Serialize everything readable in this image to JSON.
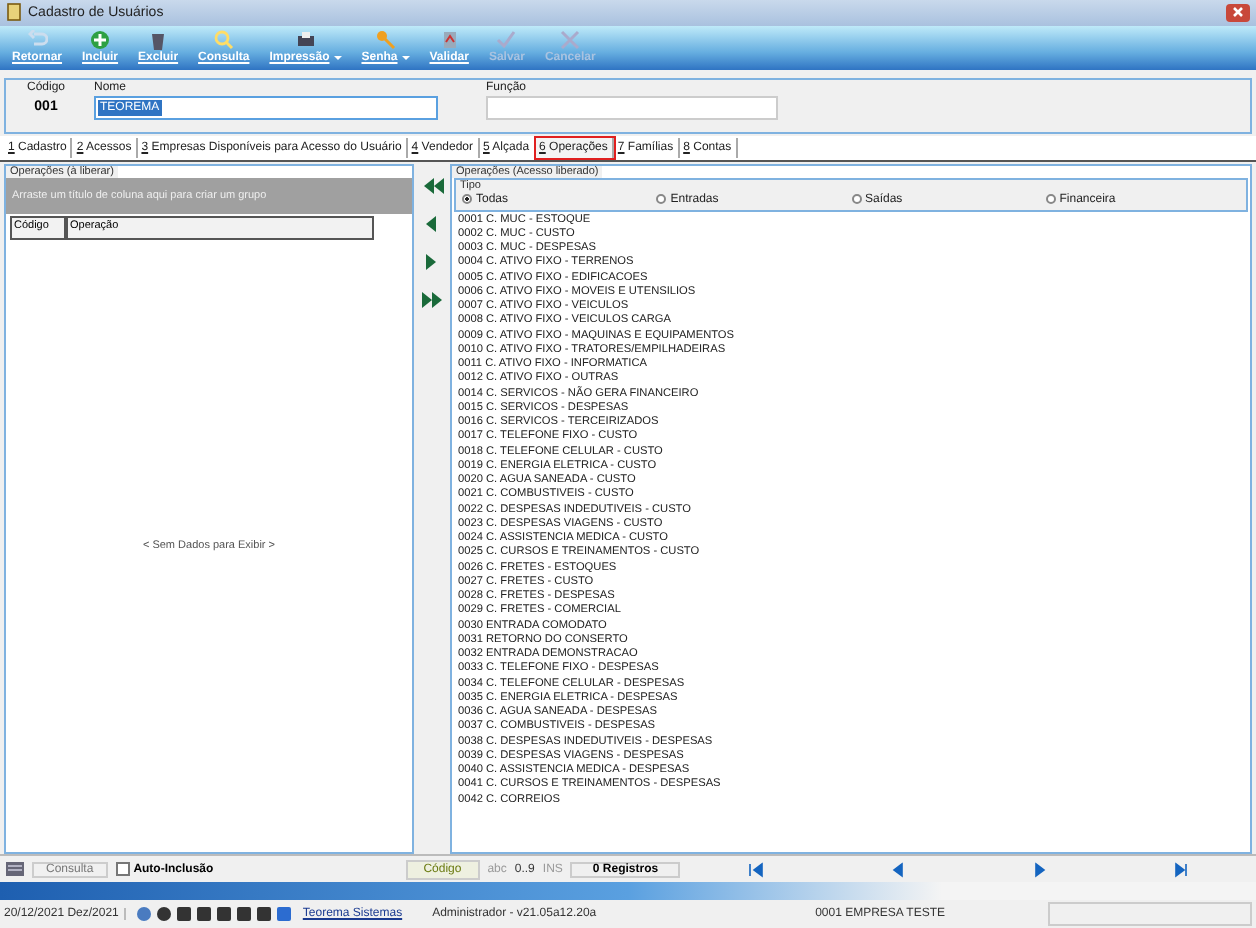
{
  "window": {
    "title": "Cadastro de Usuários"
  },
  "toolbar": [
    {
      "label": "Retornar",
      "disabled": false,
      "dropdown": false
    },
    {
      "label": "Incluir",
      "disabled": false,
      "dropdown": false
    },
    {
      "label": "Excluir",
      "disabled": false,
      "dropdown": false
    },
    {
      "label": "Consulta",
      "disabled": false,
      "dropdown": false
    },
    {
      "label": "Impressão",
      "disabled": false,
      "dropdown": true
    },
    {
      "label": "Senha",
      "disabled": false,
      "dropdown": true
    },
    {
      "label": "Validar",
      "disabled": false,
      "dropdown": false
    },
    {
      "label": "Salvar",
      "disabled": true,
      "dropdown": false
    },
    {
      "label": "Cancelar",
      "disabled": true,
      "dropdown": false
    }
  ],
  "header": {
    "code_label": "Código",
    "code": "001",
    "name_label": "Nome",
    "name": "TEOREMA",
    "role_label": "Função"
  },
  "tabs": [
    {
      "accel": "1",
      "label": "Cadastro",
      "selected": false
    },
    {
      "accel": "2",
      "label": "Acessos",
      "selected": false
    },
    {
      "accel": "3",
      "label": "Empresas Disponíveis para Acesso do Usuário",
      "selected": false
    },
    {
      "accel": "4",
      "label": "Vendedor",
      "selected": false
    },
    {
      "accel": "5",
      "label": "Alçada",
      "selected": false
    },
    {
      "accel": "6",
      "label": "Operações",
      "selected": true
    },
    {
      "accel": "7",
      "label": "Famílias",
      "selected": false
    },
    {
      "accel": "8",
      "label": "Contas",
      "selected": false
    }
  ],
  "left_panel": {
    "title": "Operações (à liberar)",
    "group_hint": "Arraste um título de coluna aqui para criar um grupo",
    "columns": [
      "Código",
      "Operação"
    ],
    "empty": "< Sem Dados para Exibir >"
  },
  "right_panel": {
    "title": "Operações (Acesso liberado)",
    "filter_title": "Tipo",
    "filters": [
      {
        "label": "Todas",
        "selected": true
      },
      {
        "label": "Entradas",
        "selected": false
      },
      {
        "label": "Saídas",
        "selected": false
      },
      {
        "label": "Financeira",
        "selected": false
      }
    ],
    "items": [
      "0001 C. MUC - ESTOQUE",
      "0002 C. MUC - CUSTO",
      "0003 C. MUC - DESPESAS",
      "0004 C. ATIVO FIXO - TERRENOS",
      "0005 C. ATIVO FIXO - EDIFICACOES",
      "0006 C. ATIVO FIXO - MOVEIS E UTENSILIOS",
      "0007 C. ATIVO FIXO - VEICULOS",
      "0008 C. ATIVO FIXO - VEICULOS CARGA",
      "0009 C. ATIVO FIXO - MAQUINAS E EQUIPAMENTOS",
      "0010 C. ATIVO FIXO - TRATORES/EMPILHADEIRAS",
      "0011 C. ATIVO FIXO - INFORMATICA",
      "0012 C. ATIVO FIXO - OUTRAS",
      "0014 C. SERVICOS - NÃO GERA FINANCEIRO",
      "0015 C. SERVICOS - DESPESAS",
      "0016 C. SERVICOS - TERCEIRIZADOS",
      "0017 C. TELEFONE FIXO - CUSTO",
      "0018 C. TELEFONE CELULAR - CUSTO",
      "0019 C. ENERGIA ELETRICA - CUSTO",
      "0020 C. AGUA SANEADA - CUSTO",
      "0021 C. COMBUSTIVEIS - CUSTO",
      "0022 C. DESPESAS INDEDUTIVEIS - CUSTO",
      "0023 C. DESPESAS VIAGENS - CUSTO",
      "0024 C. ASSISTENCIA MEDICA - CUSTO",
      "0025 C. CURSOS E TREINAMENTOS - CUSTO",
      "0026 C. FRETES - ESTOQUES",
      "0027 C. FRETES - CUSTO",
      "0028 C. FRETES - DESPESAS",
      "0029 C. FRETES - COMERCIAL",
      "0030 ENTRADA COMODATO",
      "0031 RETORNO DO CONSERTO",
      "0032 ENTRADA DEMONSTRACAO",
      "0033 C. TELEFONE FIXO - DESPESAS",
      "0034 C. TELEFONE CELULAR - DESPESAS",
      "0035 C. ENERGIA ELETRICA - DESPESAS",
      "0036 C. AGUA SANEADA - DESPESAS",
      "0037 C. COMBUSTIVEIS - DESPESAS",
      "0038 C. DESPESAS INDEDUTIVEIS - DESPESAS",
      "0039 C. DESPESAS VIAGENS - DESPESAS",
      "0040 C. ASSISTENCIA MEDICA - DESPESAS",
      "0041 C. CURSOS E TREINAMENTOS - DESPESAS",
      "0042 C. CORREIOS"
    ]
  },
  "bottom_bar": {
    "mode": "Consulta",
    "auto_label": "Auto-Inclusão",
    "auto_checked": false,
    "field": "Código",
    "abc": "abc",
    "digits": "0..9",
    "ins": "INS",
    "records": "0 Registros"
  },
  "status_bar": {
    "date": "20/12/2021 Dez/2021",
    "link": "Teorema Sistemas",
    "user": "Administrador - v21.05a12.20a",
    "company": "0001 EMPRESA TESTE"
  }
}
